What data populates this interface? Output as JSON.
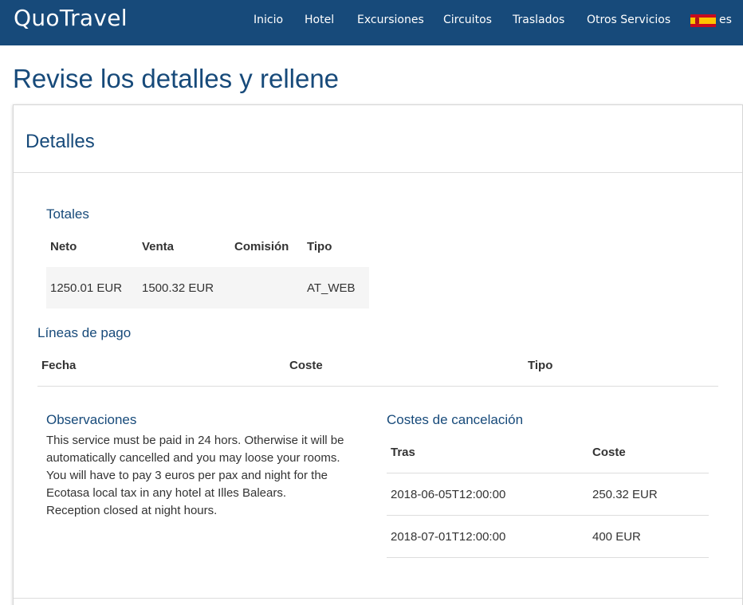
{
  "navbar": {
    "brand": "QuoTravel",
    "items": [
      {
        "label": "Inicio"
      },
      {
        "label": "Hotel"
      },
      {
        "label": "Excursiones"
      },
      {
        "label": "Circuitos"
      },
      {
        "label": "Traslados"
      },
      {
        "label": "Otros Servicios"
      }
    ],
    "language": "es",
    "flag_icon": "spain-flag-icon"
  },
  "page_title": "Revise los detalles y rellene",
  "details": {
    "title": "Detalles",
    "totals": {
      "title": "Totales",
      "headers": [
        "Neto",
        "Venta",
        "Comisión",
        "Tipo"
      ],
      "row": [
        "1250.01 EUR",
        "1500.32 EUR",
        "",
        "AT_WEB"
      ]
    },
    "payment_lines": {
      "title": "Líneas de pago",
      "headers": [
        "Fecha",
        "Coste",
        "Tipo"
      ]
    },
    "observations": {
      "title": "Observaciones",
      "lines": [
        "This service must be paid in 24 hors. Otherwise it will be",
        "automatically cancelled and you may loose your rooms.",
        "You will have to pay 3 euros per pax and night for the",
        "Ecotasa local tax in any hotel at Illes Balears.",
        "Reception closed at night hours."
      ]
    },
    "cancellation_costs": {
      "title": "Costes de cancelación",
      "headers": [
        "Tras",
        "Coste"
      ],
      "rows": [
        [
          "2018-06-05T12:00:00",
          "250.32 EUR"
        ],
        [
          "2018-07-01T12:00:00",
          "400 EUR"
        ]
      ]
    }
  },
  "colors": {
    "navbar_bg": "#174a7a",
    "title_color": "#174a7a",
    "row_highlight": "#f5f5f5"
  }
}
